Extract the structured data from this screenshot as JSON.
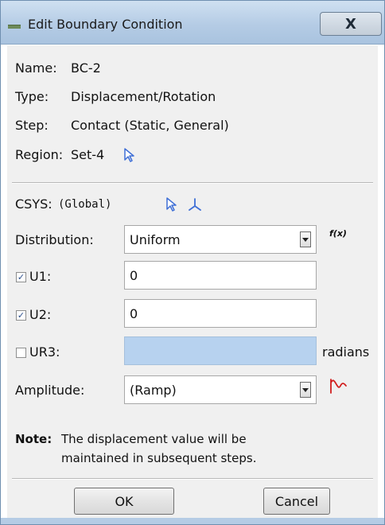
{
  "window": {
    "title": "Edit Boundary Condition",
    "close_label": "X"
  },
  "info": {
    "name_label": "Name:",
    "name_value": "BC-2",
    "type_label": "Type:",
    "type_value": "Displacement/Rotation",
    "step_label": "Step:",
    "step_value": "Contact (Static, General)",
    "region_label": "Region:",
    "region_value": "Set-4"
  },
  "csys": {
    "label": "CSYS:",
    "value": "(Global)"
  },
  "distribution": {
    "label": "Distribution:",
    "value": "Uniform",
    "fx_label": "f(x)"
  },
  "dofs": [
    {
      "label": "U1:",
      "checked": true,
      "value": "0"
    },
    {
      "label": "U2:",
      "checked": true,
      "value": "0"
    },
    {
      "label": "UR3:",
      "checked": false,
      "value": "",
      "unit": "radians"
    }
  ],
  "amplitude": {
    "label": "Amplitude:",
    "value": "(Ramp)"
  },
  "note": {
    "prefix": "Note:",
    "line1": "The displacement value will be",
    "line2": "maintained in subsequent steps."
  },
  "buttons": {
    "ok": "OK",
    "cancel": "Cancel"
  },
  "icons": {
    "app": "window-menu-icon",
    "select": "select-arrow-icon",
    "csys_axes": "csys-axes-icon",
    "amplitude": "amplitude-curve-icon"
  },
  "colors": {
    "disabled_field": "#b7d2ef",
    "icon_blue": "#3f6fd6",
    "icon_red": "#d11f1f"
  }
}
